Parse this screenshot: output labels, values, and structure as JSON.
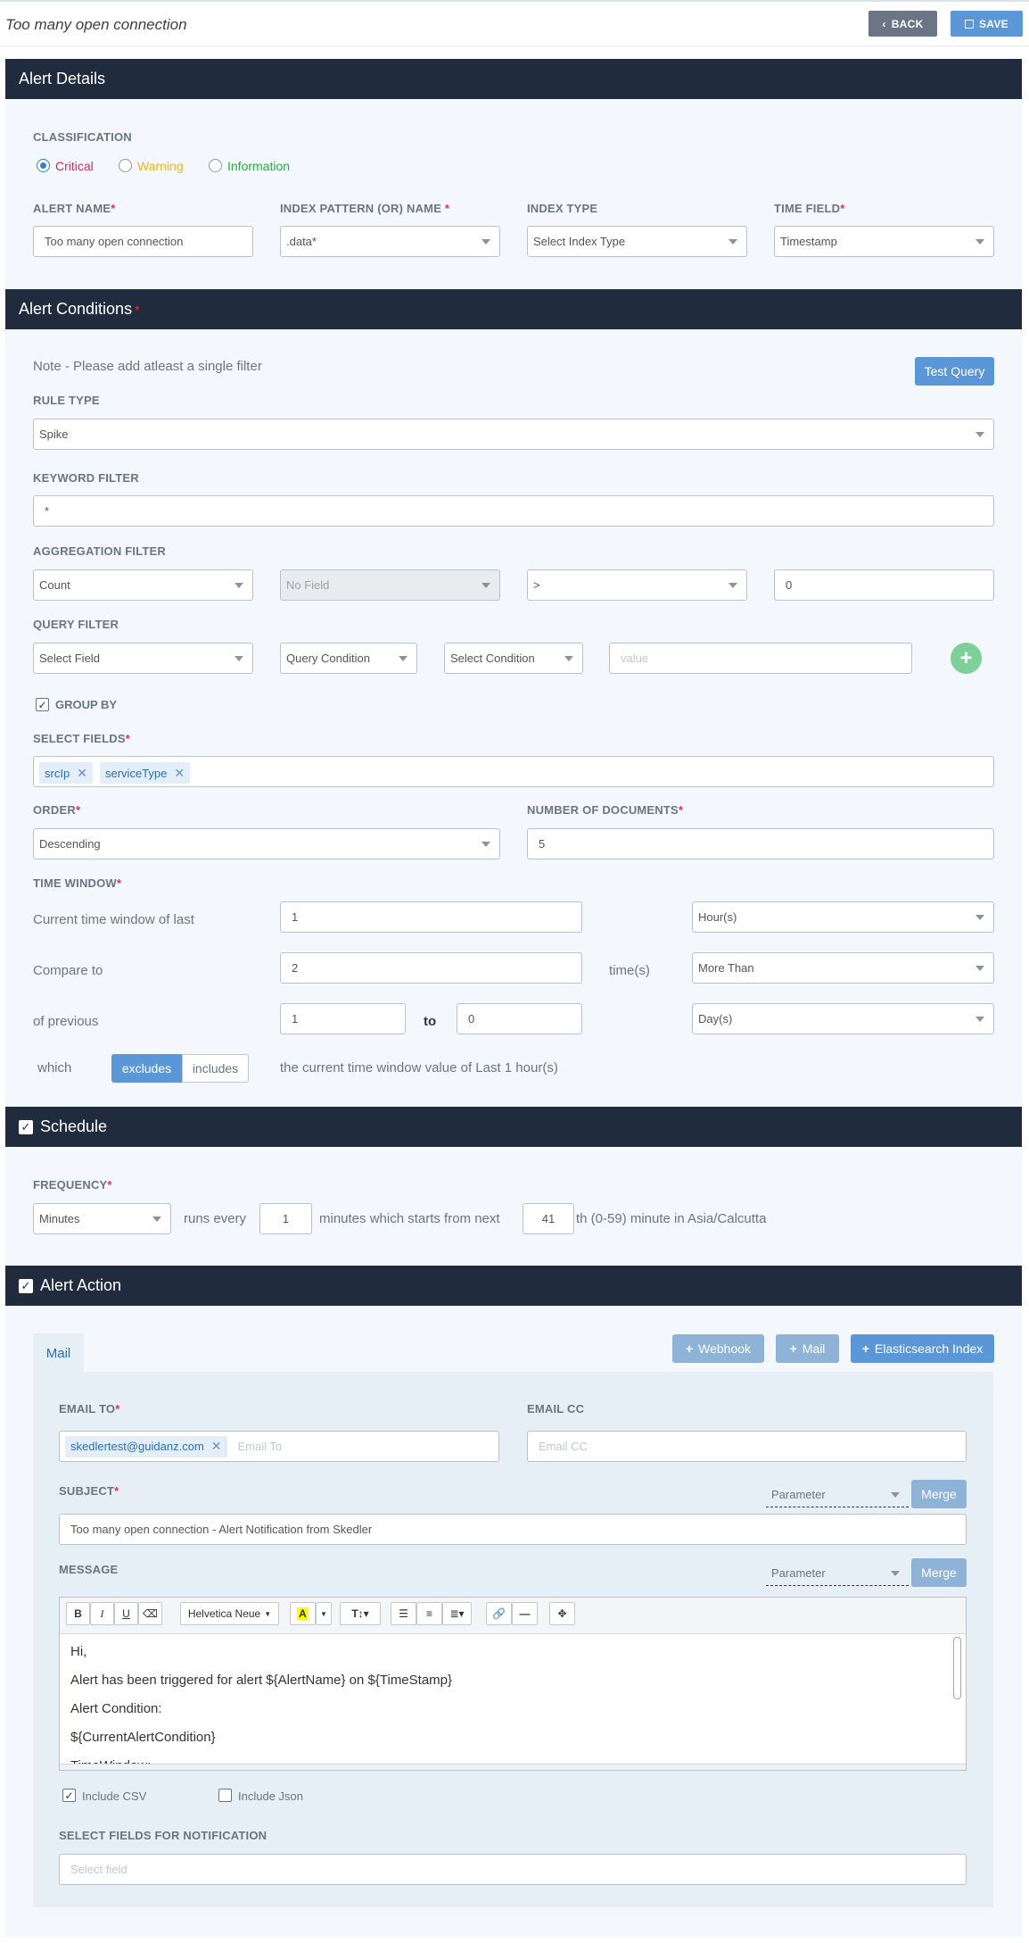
{
  "header": {
    "title": "Too many open connection",
    "back_label": "BACK",
    "save_label": "SAVE"
  },
  "alert_details": {
    "section_title": "Alert Details",
    "classification_label": "CLASSIFICATION",
    "classification_options": [
      {
        "label": "Critical",
        "color": "#e0245e",
        "selected": true
      },
      {
        "label": "Warning",
        "color": "#f0b322",
        "selected": false
      },
      {
        "label": "Information",
        "color": "#2ea64a",
        "selected": false
      }
    ],
    "alert_name_label": "ALERT NAME",
    "alert_name_value": "Too many open connection",
    "index_pattern_label": "INDEX PATTERN (OR) NAME",
    "index_pattern_value": ".data*",
    "index_type_label": "INDEX TYPE",
    "index_type_value": "Select Index Type",
    "time_field_label": "TIME FIELD",
    "time_field_value": "Timestamp"
  },
  "alert_conditions": {
    "section_title": "Alert Conditions",
    "note": "Note - Please add atleast a single filter",
    "test_query_label": "Test Query",
    "rule_type_label": "RULE TYPE",
    "rule_type_value": "Spike",
    "keyword_filter_label": "KEYWORD FILTER",
    "keyword_filter_value": "*",
    "aggregation_filter_label": "AGGREGATION FILTER",
    "aggregation": {
      "function": "Count",
      "field": "No Field",
      "operator": ">",
      "value": "0"
    },
    "query_filter_label": "QUERY FILTER",
    "query_filter": {
      "field": "Select Field",
      "condition": "Query Condition",
      "select_condition": "Select Condition",
      "value_placeholder": "value"
    },
    "group_by_label": "GROUP BY",
    "group_by_checked": true,
    "select_fields_label": "SELECT FIELDS",
    "select_fields": [
      "srcIp",
      "serviceType"
    ],
    "order_label": "ORDER",
    "order_value": "Descending",
    "num_docs_label": "NUMBER OF DOCUMENTS",
    "num_docs_value": "5",
    "time_window_label": "TIME WINDOW",
    "current_window_text": "Current time window of last",
    "current_window_value": "1",
    "current_window_unit": "Hour(s)",
    "compare_to_text": "Compare to",
    "compare_to_value": "2",
    "times_text": "time(s)",
    "compare_mode": "More Than",
    "previous_text": "of previous",
    "previous_from": "1",
    "to_text": "to",
    "previous_to": "0",
    "previous_unit": "Day(s)",
    "which_text": "which",
    "excludes_label": "excludes",
    "includes_label": "includes",
    "summary_text": "the current time window value of Last 1 hour(s)"
  },
  "schedule": {
    "section_title": "Schedule",
    "frequency_label": "FREQUENCY",
    "frequency_value": "Minutes",
    "runs_every_text": "runs  every",
    "every_value": "1",
    "minutes_text": "minutes  which starts from next",
    "start_minute": "41",
    "suffix_text": "th (0-59) minute in  Asia/Calcutta"
  },
  "alert_action": {
    "section_title": "Alert Action",
    "tab_mail": "Mail",
    "webhook_label": "Webhook",
    "mail_label": "Mail",
    "es_index_label": "Elasticsearch Index",
    "email_to_label": "EMAIL TO",
    "email_to_tags": [
      "skedlertest@guidanz.com"
    ],
    "email_to_placeholder": "Email To",
    "email_cc_label": "EMAIL CC",
    "email_cc_placeholder": "Email CC",
    "subject_label": "SUBJECT",
    "parameter_label": "Parameter",
    "merge_label": "Merge",
    "subject_value": "Too many open connection - Alert Notification from Skedler",
    "message_label": "MESSAGE",
    "font_name": "Helvetica Neue",
    "message_lines": [
      "Hi,",
      "Alert has been triggered for alert ${AlertName} on ${TimeStamp}",
      "Alert Condition:",
      "${CurrentAlertCondition}",
      "TimeWindow:"
    ],
    "include_csv_label": "Include CSV",
    "include_csv_checked": true,
    "include_json_label": "Include Json",
    "include_json_checked": false,
    "select_fields_notif_label": "SELECT FIELDS FOR NOTIFICATION",
    "select_field_placeholder": "Select field"
  },
  "colors": {
    "section_bar": "#212b3e",
    "primary": "#5b97d6",
    "required": "#e5324b",
    "add_button": "#7ed09a"
  }
}
